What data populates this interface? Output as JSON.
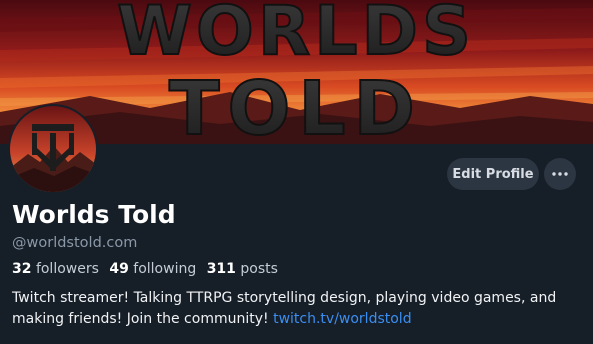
{
  "banner": {
    "line1": "WORLDS",
    "line2": "TOLD"
  },
  "avatar": {
    "label": "Worlds Told avatar"
  },
  "actions": {
    "edit_profile": "Edit Profile",
    "more_icon": "more-dots-icon"
  },
  "profile": {
    "display_name": "Worlds Told",
    "handle": "@worldstold.com"
  },
  "stats": {
    "followers_count": "32",
    "followers_label": "followers",
    "following_count": "49",
    "following_label": "following",
    "posts_count": "311",
    "posts_label": "posts"
  },
  "bio": {
    "text": "Twitch streamer! Talking TTRPG storytelling design, playing video games, and making friends! Join the community!",
    "link_text": "twitch.tv/worldstold"
  },
  "colors": {
    "background": "#161e27",
    "button": "#2c3642",
    "link": "#3b8ef2",
    "muted": "#8a98a8"
  }
}
